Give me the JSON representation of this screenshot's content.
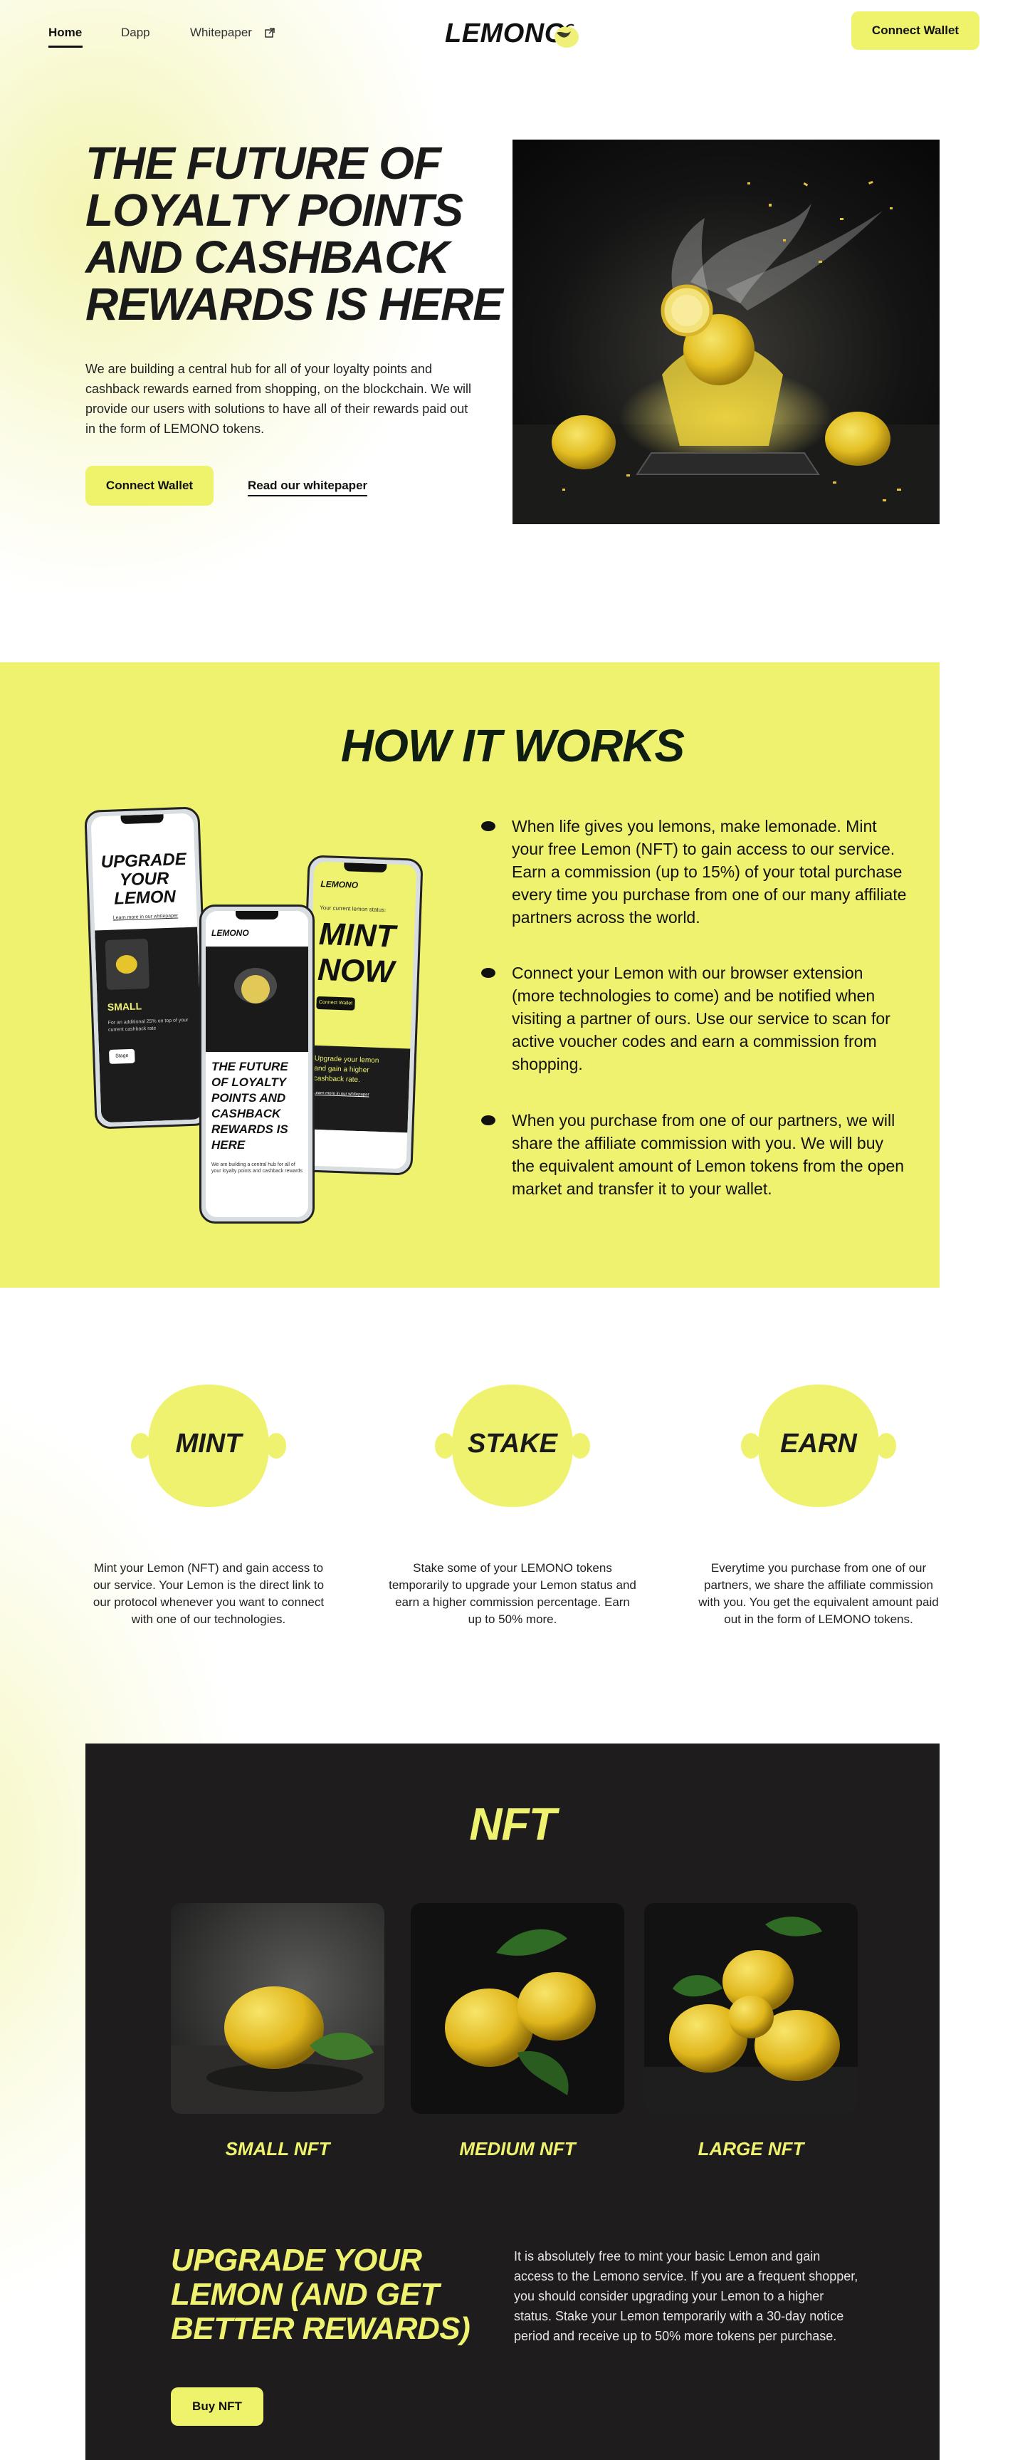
{
  "nav": {
    "links": [
      {
        "label": "Home"
      },
      {
        "label": "Dapp"
      },
      {
        "label": "Whitepaper"
      }
    ],
    "logo_text": "LEMONO",
    "cta_label": "Connect Wallet"
  },
  "hero": {
    "title": "THE FUTURE OF LOYALTY POINTS AND CASHBACK REWARDS IS HERE",
    "description": "We are building a central hub for all of your loyalty points and cashback rewards earned from shopping, on the blockchain. We will provide our users with solutions to have all of their rewards paid out in the form of LEMONO tokens.",
    "primary_cta": "Connect Wallet",
    "secondary_cta": "Read our whitepaper"
  },
  "how": {
    "title": "HOW IT WORKS",
    "phone_left": {
      "heading": "UPGRADE YOUR LEMON",
      "link": "Learn more in our whitepaper",
      "tier": "SMALL",
      "tier_text": "For an additional 25% on top of your current cashback rate",
      "button": "Stage"
    },
    "phone_center": {
      "logo": "LEMONO",
      "heading": "THE FUTURE OF LOYALTY POINTS AND CASHBACK REWARDS IS HERE",
      "text": "We are building a central hub for all of your loyalty points and cashback rewards"
    },
    "phone_right": {
      "logo": "LEMONO",
      "status": "Your current lemon status:",
      "heading": "MINT NOW",
      "button": "Connect Wallet",
      "text": "Upgrade your lemon and gain a higher cashback rate.",
      "link": "Learn more in our whitepaper"
    },
    "steps": [
      "When life gives you lemons, make lemonade. Mint your free Lemon (NFT) to gain access to our service. Earn a commission (up to 15%) of your total purchase every time you purchase from one of our many affiliate partners across the world.",
      "Connect your Lemon with our browser extension (more technologies to come) and be notified when visiting a partner of ours. Use our service to scan for active voucher codes and earn a commission from shopping.",
      "When you purchase from one of our partners, we will share the affiliate commission with you. We will buy the equivalent amount of Lemon tokens from the open market and transfer it to your wallet."
    ]
  },
  "features": [
    {
      "label": "MINT",
      "description": "Mint your Lemon (NFT) and gain access to our service. Your Lemon is the direct link to our protocol whenever you want to connect with one of our technologies."
    },
    {
      "label": "STAKE",
      "description": "Stake some of your LEMONO tokens temporarily to upgrade your Lemon status and earn a higher commission percentage. Earn up to 50% more."
    },
    {
      "label": "EARN",
      "description": "Everytime you purchase from one of our partners, we share the affiliate commission with you. You get the equivalent amount paid out in the form of LEMONO tokens."
    }
  ],
  "nft": {
    "title": "NFT",
    "cards": [
      {
        "name": "SMALL NFT"
      },
      {
        "name": "MEDIUM NFT"
      },
      {
        "name": "LARGE NFT"
      }
    ],
    "upgrade_title": "UPGRADE YOUR LEMON (AND GET BETTER REWARDS)",
    "upgrade_text": "It is absolutely free to mint your basic Lemon and gain access to the Lemono service. If you are a frequent shopper, you should consider upgrading your Lemon to a higher status. Stake your Lemon temporarily with a 30-day notice period and receive up to 50% more tokens per purchase.",
    "buy_label": "Buy NFT"
  },
  "colors": {
    "accent": "#eff26e",
    "dark": "#1e1c1d",
    "text": "#1c1c1c"
  },
  "icons": [
    "external-link-icon",
    "lemon-logo-icon",
    "bullet-dot-icon"
  ]
}
